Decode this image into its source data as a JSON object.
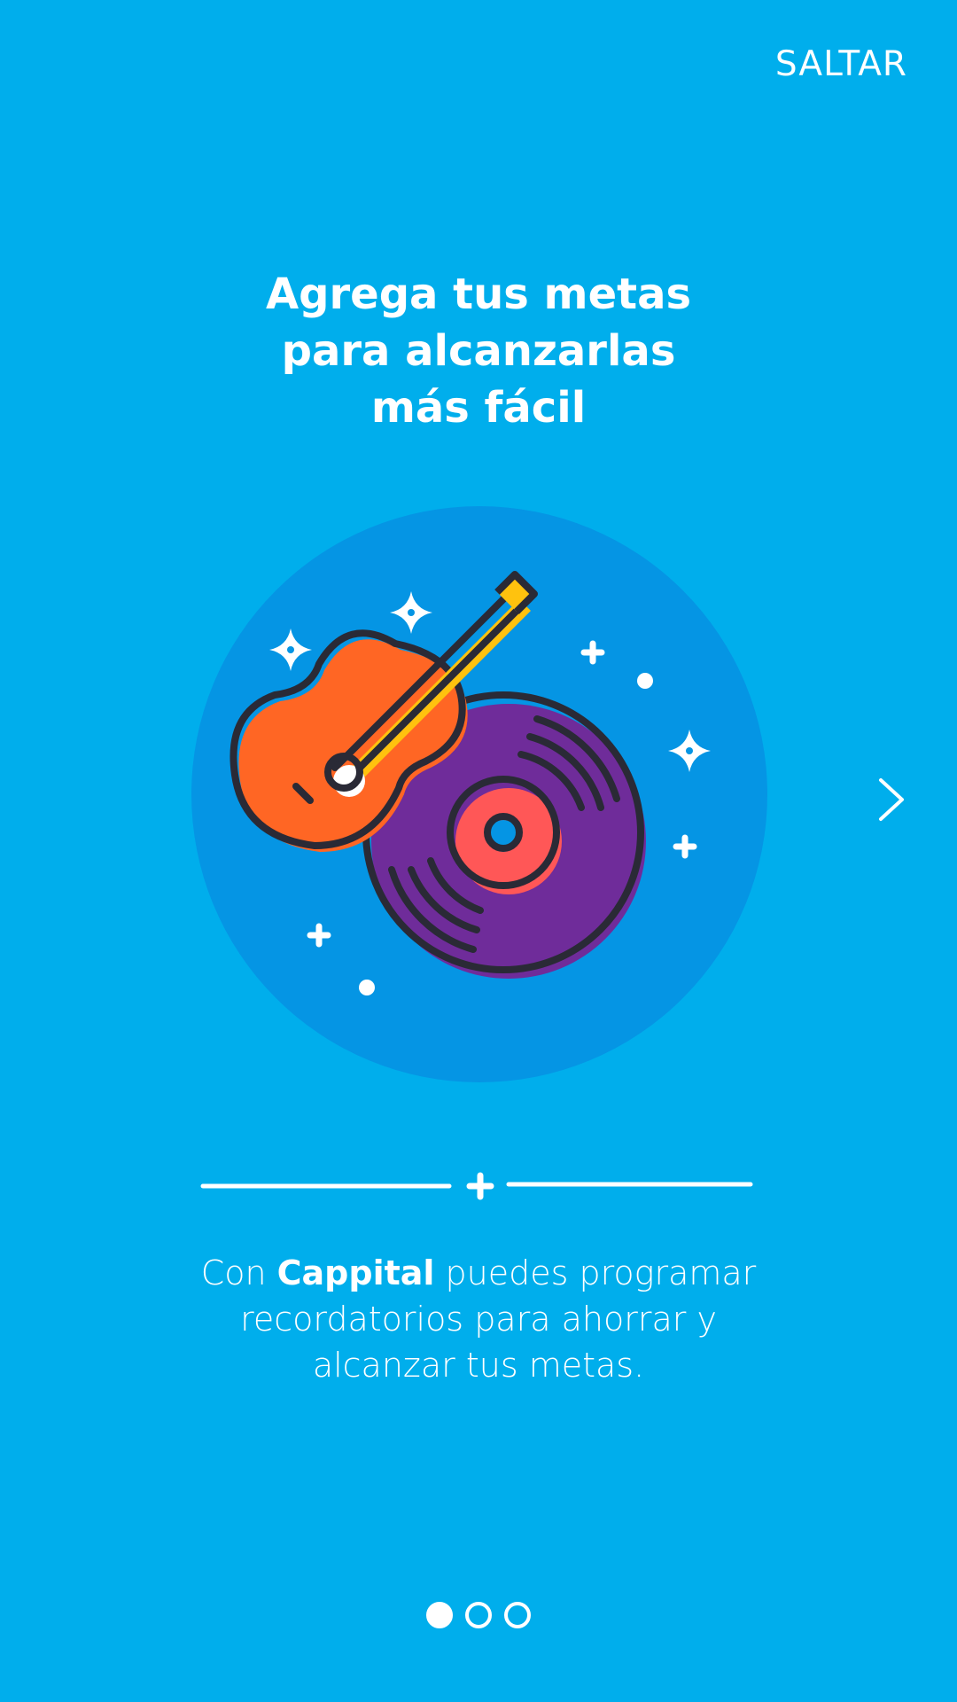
{
  "header": {
    "skip_label": "SALTAR"
  },
  "main": {
    "title_lines": [
      "Agrega tus metas",
      "para alcanzarlas",
      "más fácil"
    ],
    "description": {
      "line1_prefix": "Con ",
      "line1_brand": "Cappital",
      "line1_suffix": " puedes programar",
      "line2": "recordatorios para ahorrar y",
      "line3": "alcanzar tus metas."
    }
  },
  "illustration": {
    "name": "guitar-and-vinyl-record",
    "icons": [
      "guitar-icon",
      "vinyl-record-icon",
      "sparkle-icon",
      "plus-icon",
      "dot-icon"
    ]
  },
  "navigation": {
    "next_icon": "chevron-right-icon",
    "page_count": 3,
    "current_page": 1
  },
  "colors": {
    "background": "#00aeec",
    "circle": "#0595e4",
    "guitar": "#ff6624",
    "vinyl": "#6f2c9a",
    "label": "#ff5757",
    "neck": "#ffc20e",
    "outline": "#2a2a36",
    "white": "#ffffff"
  }
}
